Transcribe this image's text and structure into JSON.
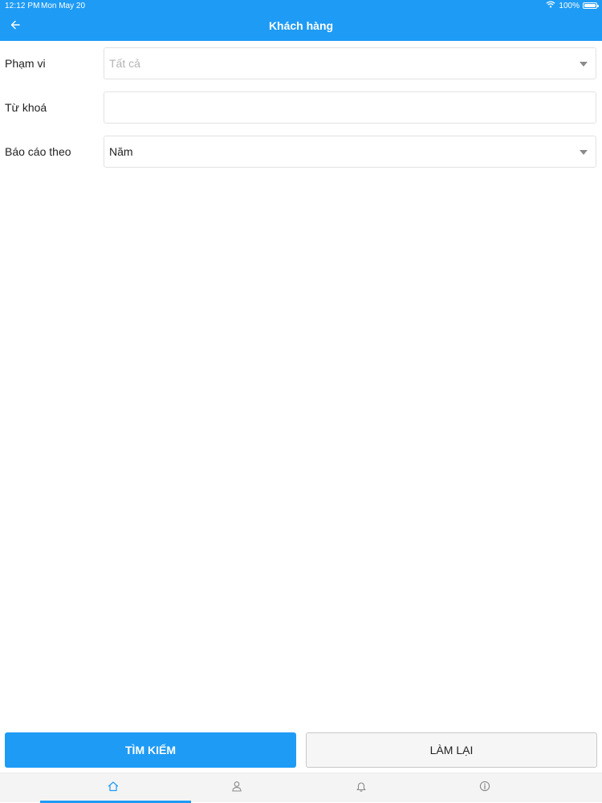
{
  "status_bar": {
    "time": "12:12 PM",
    "date": "Mon May 20",
    "battery": "100%"
  },
  "header": {
    "title": "Khách hàng",
    "back_icon": "arrow-left-icon"
  },
  "form": {
    "scope": {
      "label": "Phạm vi",
      "placeholder": "Tất cả"
    },
    "keyword": {
      "label": "Từ khoá",
      "value": ""
    },
    "report_by": {
      "label": "Báo cáo theo",
      "value": "Năm"
    }
  },
  "actions": {
    "search_label": "TÌM KIẾM",
    "reset_label": "LÀM LẠI"
  },
  "tabs": [
    {
      "icon": "home-icon",
      "active": true
    },
    {
      "icon": "user-icon",
      "active": false
    },
    {
      "icon": "bell-icon",
      "active": false
    },
    {
      "icon": "info-icon",
      "active": false
    }
  ],
  "colors": {
    "primary": "#1e9bf5",
    "placeholder": "#b4b4b4",
    "border": "#e2e2e2",
    "tabbar": "#f4f4f4"
  }
}
